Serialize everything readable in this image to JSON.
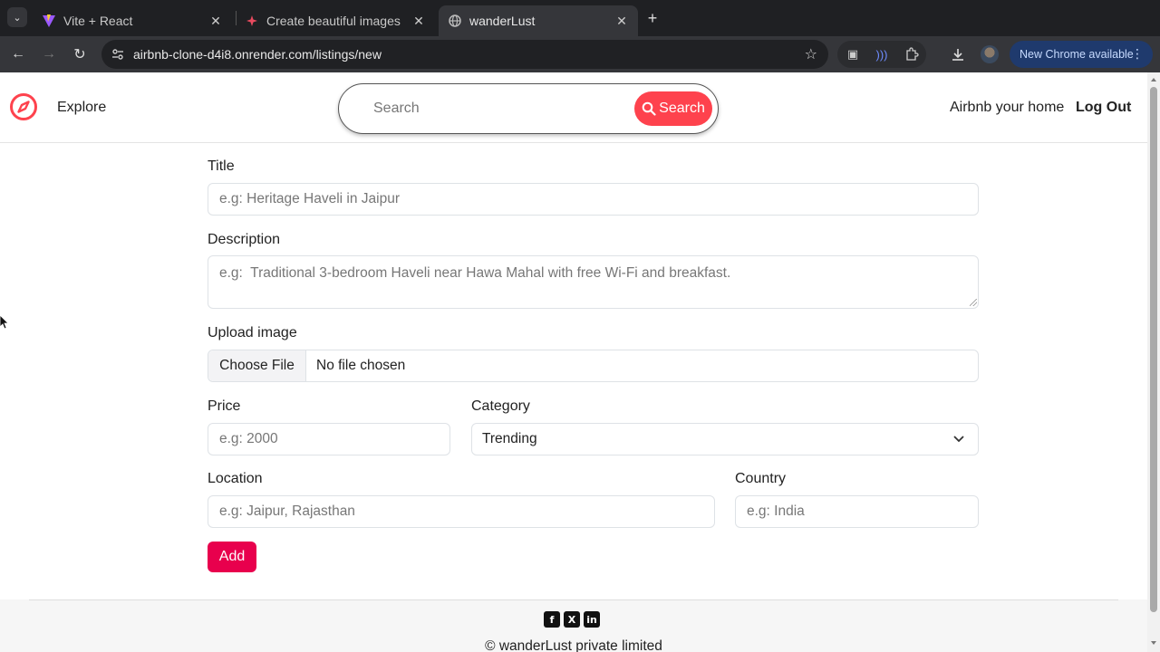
{
  "browser": {
    "tabs": [
      {
        "title": "Vite + React",
        "icon": "vite-icon",
        "active": false
      },
      {
        "title": "Create beautiful images",
        "icon": "gemini-icon",
        "active": false
      },
      {
        "title": "wanderLust",
        "icon": "globe-icon",
        "active": true
      }
    ],
    "url": "airbnb-clone-d4i8.onrender.com/listings/new",
    "update_label": "New Chrome available"
  },
  "nav": {
    "explore_label": "Explore",
    "search_placeholder": "Search",
    "search_button_label": "Search",
    "host_label": "Airbnb your home",
    "logout_label": "Log Out",
    "brand_color": "#fe424d"
  },
  "form": {
    "title_label": "Title",
    "title_placeholder": "e.g: Heritage Haveli in Jaipur",
    "description_label": "Description",
    "description_placeholder": "e.g:  Traditional 3-bedroom Haveli near Hawa Mahal with free Wi-Fi and breakfast.",
    "upload_label": "Upload image",
    "file_button_label": "Choose File",
    "file_status": "No file chosen",
    "price_label": "Price",
    "price_placeholder": "e.g: 2000",
    "category_label": "Category",
    "category_selected": "Trending",
    "location_label": "Location",
    "location_placeholder": "e.g: Jaipur, Rajasthan",
    "country_label": "Country",
    "country_placeholder": "e.g: India",
    "submit_label": "Add",
    "submit_color": "#e8004d"
  },
  "footer": {
    "socials": [
      "facebook-icon",
      "x-icon",
      "linkedin-icon"
    ],
    "copyright": "© wanderLust private limited"
  }
}
